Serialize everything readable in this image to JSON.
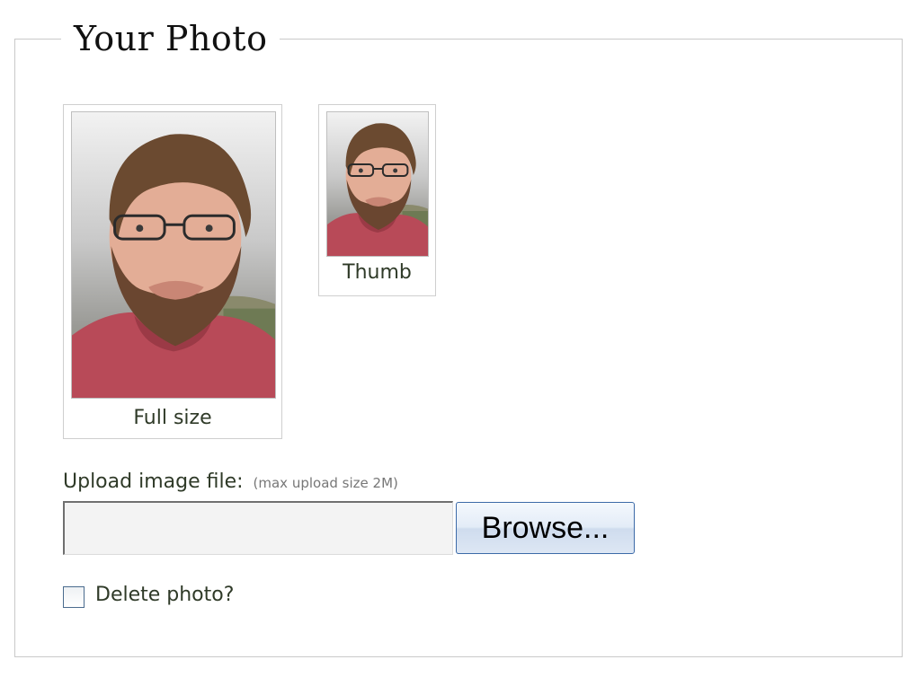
{
  "section": {
    "legend": "Your Photo"
  },
  "photos": [
    {
      "caption": "Full size",
      "image_icon": "portrait-photo"
    },
    {
      "caption": "Thumb",
      "image_icon": "portrait-photo"
    }
  ],
  "upload": {
    "label": "Upload image file:",
    "hint": "(max upload size 2M)",
    "file_value": "",
    "browse_label": "Browse..."
  },
  "delete": {
    "label": "Delete photo?",
    "checked": false
  },
  "colors": {
    "label_text": "#2f3a28",
    "fieldset_border": "#c9c9c9",
    "button_border": "#3c6aa8"
  }
}
